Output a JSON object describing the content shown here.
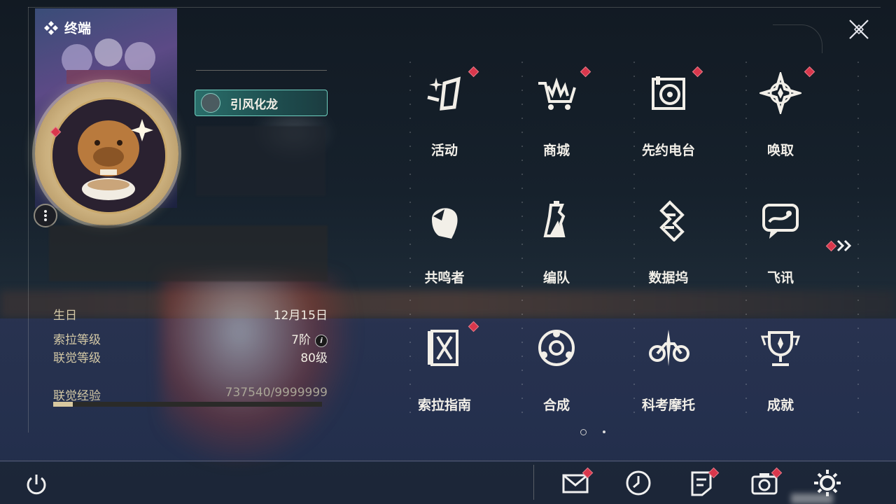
{
  "terminal": {
    "label": "终端"
  },
  "profile": {
    "title_badge": "引风化龙",
    "stats": [
      {
        "label": "生日",
        "value": "12月15日",
        "info": false
      },
      {
        "label": "索拉等级",
        "value": "7阶",
        "info": true
      },
      {
        "label": "联觉等级",
        "value": "80级",
        "info": false
      }
    ],
    "exp": {
      "label": "联觉经验",
      "value": "737540/9999999",
      "progress_fraction": 0.0737
    }
  },
  "menu": [
    {
      "label": "活动",
      "icon": "sparkle-activity-icon",
      "badge": true
    },
    {
      "label": "商城",
      "icon": "shop-cart-icon",
      "badge": true
    },
    {
      "label": "先约电台",
      "icon": "radio-turntable-icon",
      "badge": true
    },
    {
      "label": "唤取",
      "icon": "summon-compass-icon",
      "badge": true
    },
    {
      "label": "共鸣者",
      "icon": "resonator-head-icon",
      "badge": false
    },
    {
      "label": "编队",
      "icon": "chess-team-icon",
      "badge": false
    },
    {
      "label": "数据坞",
      "icon": "data-bank-icon",
      "badge": false
    },
    {
      "label": "飞讯",
      "icon": "message-chat-icon",
      "badge": false
    },
    {
      "label": "索拉指南",
      "icon": "guide-book-icon",
      "badge": true
    },
    {
      "label": "合成",
      "icon": "synthesis-circle-icon",
      "badge": false
    },
    {
      "label": "科考摩托",
      "icon": "motorbike-icon",
      "badge": false
    },
    {
      "label": "成就",
      "icon": "trophy-icon",
      "badge": false
    }
  ],
  "next_page_badge": true,
  "pager": {
    "current": 1,
    "total": 2
  },
  "bottom_bar": [
    {
      "icon": "mail-icon",
      "badge": true
    },
    {
      "icon": "clock-icon",
      "badge": false
    },
    {
      "icon": "notes-icon",
      "badge": true
    },
    {
      "icon": "camera-icon",
      "badge": true
    },
    {
      "icon": "settings-gear-icon",
      "badge": false
    }
  ],
  "colors": {
    "badge_red": "#d9374c",
    "accent_gold": "#d4c9a6",
    "title_teal": "#2a6e6a"
  }
}
